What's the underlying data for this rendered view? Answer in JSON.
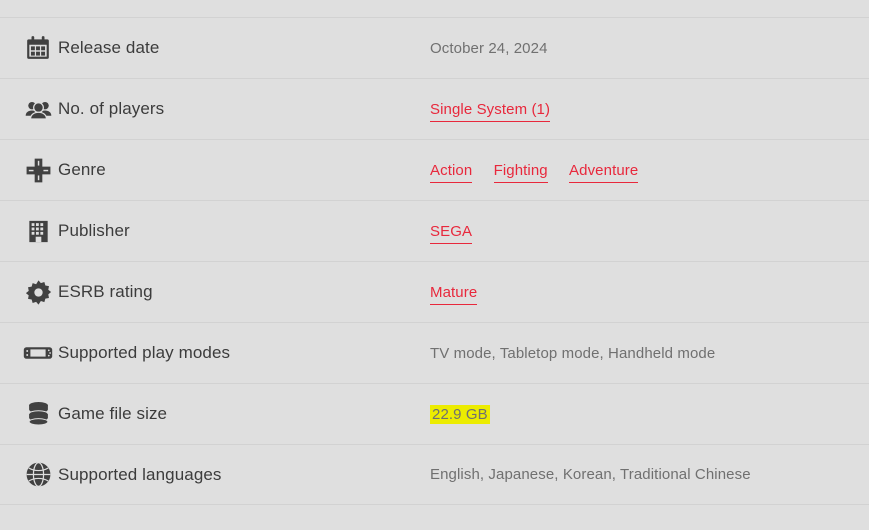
{
  "table": {
    "rows": [
      {
        "icon": "calendar-icon",
        "label": "Release date",
        "value_type": "text",
        "value": "October 24, 2024"
      },
      {
        "icon": "players-group-icon",
        "label": "No. of players",
        "value_type": "links",
        "links": [
          "Single System (1)"
        ]
      },
      {
        "icon": "dpad-icon",
        "label": "Genre",
        "value_type": "links",
        "links": [
          "Action",
          "Fighting",
          "Adventure"
        ]
      },
      {
        "icon": "building-icon",
        "label": "Publisher",
        "value_type": "links",
        "links": [
          "SEGA"
        ]
      },
      {
        "icon": "gear-icon",
        "label": "ESRB rating",
        "value_type": "links",
        "links": [
          "Mature"
        ]
      },
      {
        "icon": "switch-console-icon",
        "label": "Supported play modes",
        "value_type": "text",
        "value": "TV mode, Tabletop mode, Handheld mode"
      },
      {
        "icon": "database-icon",
        "label": "Game file size",
        "value_type": "highlighted",
        "value": "22.9 GB"
      },
      {
        "icon": "globe-icon",
        "label": "Supported languages",
        "value_type": "text",
        "value": "English, Japanese, Korean, Traditional Chinese"
      }
    ]
  },
  "colors": {
    "background": "#dfdfdf",
    "divider": "#d2d2d2",
    "label_text": "#3c3c3c",
    "value_text": "#707070",
    "link_red": "#e8283c",
    "highlight_yellow": "#ecec00",
    "icon": "#414141"
  }
}
